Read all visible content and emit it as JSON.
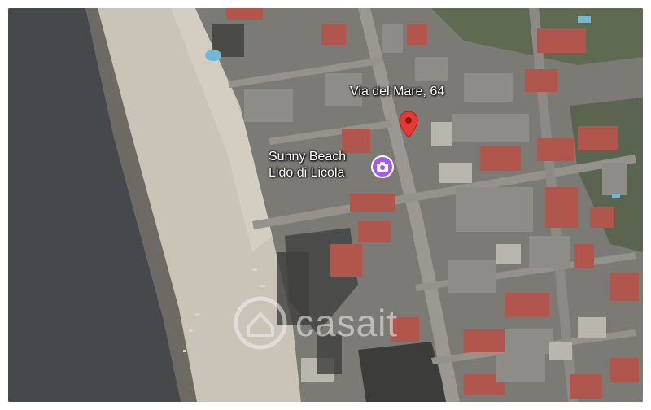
{
  "map": {
    "type": "satellite",
    "address_label": "Via del Mare, 64",
    "poi_label_line1": "Sunny Beach",
    "poi_label_line2": "Lido di Licola",
    "pin_color": "#e53935",
    "poi_color": "#a259f7",
    "icons": [
      "location-pin-icon",
      "camera-icon",
      "house-logo-icon"
    ]
  },
  "watermark": {
    "text": "casa",
    "text_tail": "it"
  }
}
